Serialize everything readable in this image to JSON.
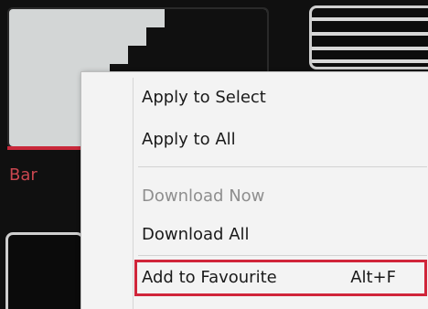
{
  "background": {
    "bar_label": "Bar"
  },
  "context_menu": {
    "items": [
      {
        "label": "Apply to Select",
        "enabled": true
      },
      {
        "label": "Apply to All",
        "enabled": true
      },
      {
        "label": "Download Now",
        "enabled": false
      },
      {
        "label": "Download All",
        "enabled": true
      },
      {
        "label": "Add to Favourite",
        "shortcut": "Alt+F",
        "enabled": true,
        "highlighted": true
      }
    ]
  },
  "colors": {
    "highlight_border": "#d0253a",
    "menu_background": "#f3f3f3",
    "disabled_text": "#8e8e8e",
    "accent_red": "#c9283a"
  }
}
